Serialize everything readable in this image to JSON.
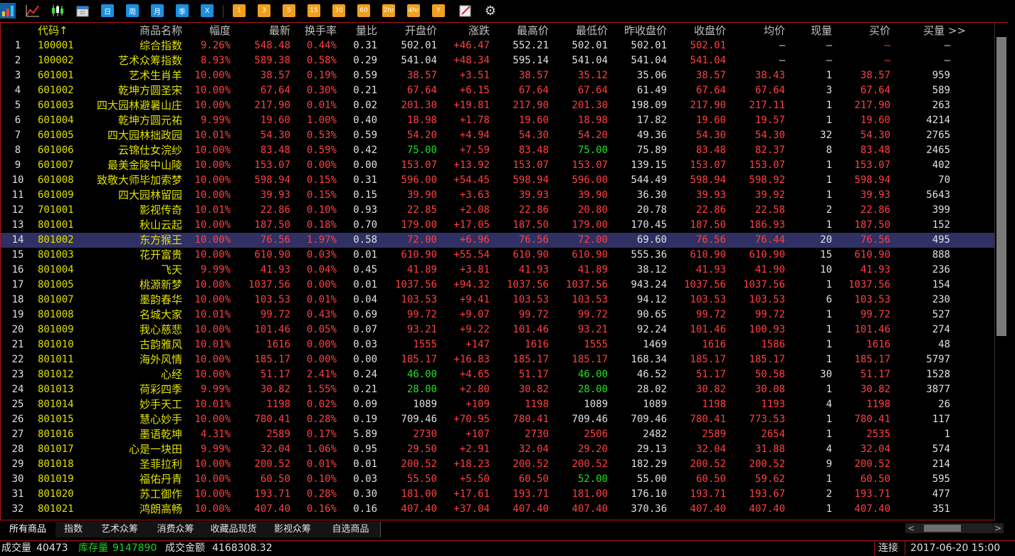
{
  "toolbar": {
    "icons": [
      "bar-chart-icon",
      "line-chart-icon",
      "candlestick-icon",
      "calendar-icon",
      "draw-icon",
      "settings-icon"
    ],
    "period_buttons": [
      "日",
      "周",
      "月",
      "季",
      "X"
    ],
    "interval_buttons": [
      "1",
      "3",
      "5",
      "15",
      "30",
      "60",
      "2hr",
      "4hr",
      "Y"
    ]
  },
  "columns": [
    "代码↑",
    "商品名称",
    "幅度",
    "最新",
    "换手率",
    "量比",
    "开盘价",
    "涨跌",
    "最高价",
    "最低价",
    "昨收盘价",
    "收盘价",
    "均价",
    "现量",
    "买价",
    "买量 >>"
  ],
  "rows": [
    [
      "1",
      "100001",
      "综合指数",
      "9.26%",
      "548.48",
      "0.44%",
      "0.31",
      "502.01",
      "+46.47",
      "552.21",
      "502.01",
      "502.01",
      "502.01",
      "—",
      "—",
      "—",
      "—"
    ],
    [
      "2",
      "100002",
      "艺术众筹指数",
      "8.93%",
      "589.38",
      "0.58%",
      "0.29",
      "541.04",
      "+48.34",
      "595.14",
      "541.04",
      "541.04",
      "541.04",
      "—",
      "—",
      "—",
      "—"
    ],
    [
      "3",
      "601001",
      "艺术生肖羊",
      "10.00%",
      "38.57",
      "0.19%",
      "0.59",
      "38.57",
      "+3.51",
      "38.57",
      "35.12",
      "35.06",
      "38.57",
      "38.43",
      "1",
      "38.57",
      "959"
    ],
    [
      "4",
      "601002",
      "乾坤方圆圣宋",
      "10.00%",
      "67.64",
      "0.30%",
      "0.21",
      "67.64",
      "+6.15",
      "67.64",
      "67.64",
      "61.49",
      "67.64",
      "67.64",
      "3",
      "67.64",
      "589"
    ],
    [
      "5",
      "601003",
      "四大园林避暑山庄",
      "10.00%",
      "217.90",
      "0.01%",
      "0.02",
      "201.30",
      "+19.81",
      "217.90",
      "201.30",
      "198.09",
      "217.90",
      "217.11",
      "1",
      "217.90",
      "263"
    ],
    [
      "6",
      "601004",
      "乾坤方圆元祐",
      "9.99%",
      "19.60",
      "1.00%",
      "0.40",
      "18.98",
      "+1.78",
      "19.60",
      "18.98",
      "17.82",
      "19.60",
      "19.57",
      "1",
      "19.60",
      "4214"
    ],
    [
      "7",
      "601005",
      "四大园林拙政园",
      "10.01%",
      "54.30",
      "0.53%",
      "0.59",
      "54.20",
      "+4.94",
      "54.30",
      "54.20",
      "49.36",
      "54.30",
      "54.30",
      "32",
      "54.30",
      "2765"
    ],
    [
      "8",
      "601006",
      "云锦仕女浣纱",
      "10.00%",
      "83.48",
      "0.59%",
      "0.42",
      "75.00",
      "+7.59",
      "83.48",
      "75.00",
      "75.89",
      "83.48",
      "82.37",
      "8",
      "83.48",
      "2465"
    ],
    [
      "9",
      "601007",
      "最美金陵中山陵",
      "10.00%",
      "153.07",
      "0.00%",
      "0.00",
      "153.07",
      "+13.92",
      "153.07",
      "153.07",
      "139.15",
      "153.07",
      "153.07",
      "1",
      "153.07",
      "402"
    ],
    [
      "10",
      "601008",
      "致敬大师毕加索梦",
      "10.00%",
      "598.94",
      "0.15%",
      "0.31",
      "596.00",
      "+54.45",
      "598.94",
      "596.00",
      "544.49",
      "598.94",
      "598.92",
      "1",
      "598.94",
      "70"
    ],
    [
      "11",
      "601009",
      "四大园林留园",
      "10.00%",
      "39.93",
      "0.15%",
      "0.15",
      "39.90",
      "+3.63",
      "39.93",
      "39.90",
      "36.30",
      "39.93",
      "39.92",
      "1",
      "39.93",
      "5643"
    ],
    [
      "12",
      "701001",
      "影视传奇",
      "10.01%",
      "22.86",
      "0.10%",
      "0.93",
      "22.85",
      "+2.08",
      "22.86",
      "20.80",
      "20.78",
      "22.86",
      "22.58",
      "2",
      "22.86",
      "399"
    ],
    [
      "13",
      "801001",
      "秋山云起",
      "10.00%",
      "187.50",
      "0.18%",
      "0.70",
      "179.00",
      "+17.05",
      "187.50",
      "179.00",
      "170.45",
      "187.50",
      "186.93",
      "1",
      "187.50",
      "152"
    ],
    [
      "14",
      "801002",
      "东方猴王",
      "10.00%",
      "76.56",
      "1.97%",
      "0.58",
      "72.00",
      "+6.96",
      "76.56",
      "72.00",
      "69.60",
      "76.56",
      "76.44",
      "20",
      "76.56",
      "495"
    ],
    [
      "15",
      "801003",
      "花开富贵",
      "10.00%",
      "610.90",
      "0.03%",
      "0.01",
      "610.90",
      "+55.54",
      "610.90",
      "610.90",
      "555.36",
      "610.90",
      "610.90",
      "15",
      "610.90",
      "888"
    ],
    [
      "16",
      "801004",
      "飞天",
      "9.99%",
      "41.93",
      "0.04%",
      "0.45",
      "41.89",
      "+3.81",
      "41.93",
      "41.89",
      "38.12",
      "41.93",
      "41.90",
      "10",
      "41.93",
      "236"
    ],
    [
      "17",
      "801005",
      "桃源新梦",
      "10.00%",
      "1037.56",
      "0.00%",
      "0.01",
      "1037.56",
      "+94.32",
      "1037.56",
      "1037.56",
      "943.24",
      "1037.56",
      "1037.56",
      "1",
      "1037.56",
      "154"
    ],
    [
      "18",
      "801007",
      "墨韵春华",
      "10.00%",
      "103.53",
      "0.01%",
      "0.04",
      "103.53",
      "+9.41",
      "103.53",
      "103.53",
      "94.12",
      "103.53",
      "103.53",
      "6",
      "103.53",
      "230"
    ],
    [
      "19",
      "801008",
      "名城大家",
      "10.01%",
      "99.72",
      "0.43%",
      "0.69",
      "99.72",
      "+9.07",
      "99.72",
      "99.72",
      "90.65",
      "99.72",
      "99.72",
      "1",
      "99.72",
      "527"
    ],
    [
      "20",
      "801009",
      "我心慈悲",
      "10.00%",
      "101.46",
      "0.05%",
      "0.07",
      "93.21",
      "+9.22",
      "101.46",
      "93.21",
      "92.24",
      "101.46",
      "100.93",
      "1",
      "101.46",
      "274"
    ],
    [
      "21",
      "801010",
      "古韵雅风",
      "10.01%",
      "1616",
      "0.00%",
      "0.03",
      "1555",
      "+147",
      "1616",
      "1555",
      "1469",
      "1616",
      "1586",
      "1",
      "1616",
      "48"
    ],
    [
      "22",
      "801011",
      "海外风情",
      "10.00%",
      "185.17",
      "0.00%",
      "0.00",
      "185.17",
      "+16.83",
      "185.17",
      "185.17",
      "168.34",
      "185.17",
      "185.17",
      "1",
      "185.17",
      "5797"
    ],
    [
      "23",
      "801012",
      "心经",
      "10.00%",
      "51.17",
      "2.41%",
      "0.24",
      "46.00",
      "+4.65",
      "51.17",
      "46.00",
      "46.52",
      "51.17",
      "50.58",
      "30",
      "51.17",
      "1528"
    ],
    [
      "24",
      "801013",
      "荷彩四季",
      "9.99%",
      "30.82",
      "1.55%",
      "0.21",
      "28.00",
      "+2.80",
      "30.82",
      "28.00",
      "28.02",
      "30.82",
      "30.08",
      "1",
      "30.82",
      "3877"
    ],
    [
      "25",
      "801014",
      "妙手天工",
      "10.01%",
      "1198",
      "0.02%",
      "0.09",
      "1089",
      "+109",
      "1198",
      "1089",
      "1089",
      "1198",
      "1193",
      "4",
      "1198",
      "26"
    ],
    [
      "26",
      "801015",
      "慧心妙手",
      "10.00%",
      "780.41",
      "0.28%",
      "0.19",
      "709.46",
      "+70.95",
      "780.41",
      "709.46",
      "709.46",
      "780.41",
      "773.53",
      "1",
      "780.41",
      "117"
    ],
    [
      "27",
      "801016",
      "墨语乾坤",
      "4.31%",
      "2589",
      "0.17%",
      "5.89",
      "2730",
      "+107",
      "2730",
      "2506",
      "2482",
      "2589",
      "2654",
      "1",
      "2535",
      "1"
    ],
    [
      "28",
      "801017",
      "心是一块田",
      "9.99%",
      "32.04",
      "1.06%",
      "0.95",
      "29.50",
      "+2.91",
      "32.04",
      "29.20",
      "29.13",
      "32.04",
      "31.88",
      "4",
      "32.04",
      "574"
    ],
    [
      "29",
      "801018",
      "圣菲拉利",
      "10.00%",
      "200.52",
      "0.01%",
      "0.01",
      "200.52",
      "+18.23",
      "200.52",
      "200.52",
      "182.29",
      "200.52",
      "200.52",
      "9",
      "200.52",
      "214"
    ],
    [
      "30",
      "801019",
      "福佑丹青",
      "10.00%",
      "60.50",
      "0.10%",
      "0.03",
      "55.50",
      "+5.50",
      "60.50",
      "52.00",
      "55.00",
      "60.50",
      "59.62",
      "1",
      "60.50",
      "595"
    ],
    [
      "31",
      "801020",
      "苏工御作",
      "10.00%",
      "193.71",
      "0.28%",
      "0.30",
      "181.00",
      "+17.61",
      "193.71",
      "181.00",
      "176.10",
      "193.71",
      "193.67",
      "2",
      "193.71",
      "477"
    ],
    [
      "32",
      "801021",
      "鸿朗高畅",
      "10.00%",
      "407.40",
      "0.16%",
      "0.16",
      "407.40",
      "+37.04",
      "407.40",
      "407.40",
      "370.36",
      "407.40",
      "407.40",
      "1",
      "407.40",
      "351"
    ]
  ],
  "selected_row": 14,
  "tabs": [
    "所有商品",
    "指数",
    "艺术众筹",
    "消费众筹",
    "收藏品现货",
    "影视众筹",
    "自选商品"
  ],
  "status": {
    "volume_label": "成交量",
    "volume": "40473",
    "stock_label": "库存量",
    "stock": "9147890",
    "amount_label": "成交金额",
    "amount": "4168308.32",
    "connection": "连接",
    "datetime": "2017-06-20 15:00"
  },
  "colors": {
    "up": "#ff4040",
    "down": "#20e020",
    "neutral": "#e0e0e0",
    "code": "#e0e000",
    "selected_row_bg": "#303064",
    "border": "#b0141c"
  }
}
